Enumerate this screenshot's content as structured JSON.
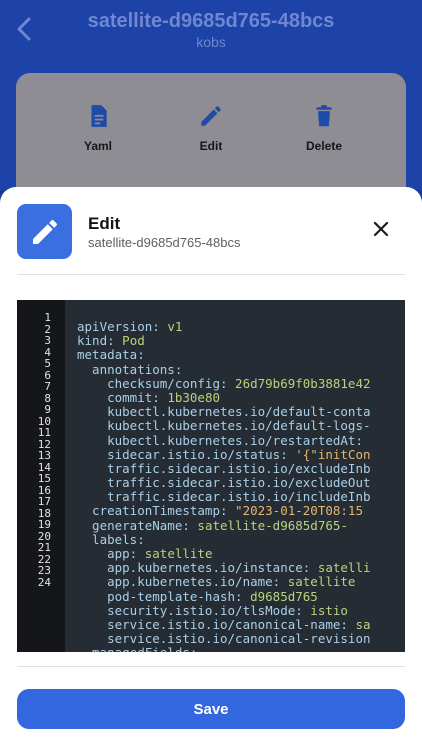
{
  "header": {
    "title": "satellite-d9685d765-48bcs",
    "subtitle": "kobs"
  },
  "actions": {
    "yaml_label": "Yaml",
    "edit_label": "Edit",
    "delete_label": "Delete"
  },
  "sheet": {
    "title": "Edit",
    "subtitle": "satellite-d9685d765-48bcs",
    "save_label": "Save"
  },
  "editor": {
    "line_numbers": [
      "1",
      "2",
      "3",
      "4",
      "5",
      "6",
      "7",
      "8",
      "9",
      "10",
      "11",
      "12",
      "13",
      "14",
      "15",
      "16",
      "17",
      "18",
      "19",
      "20",
      "21",
      "22",
      "23",
      "24"
    ],
    "lines": [
      "apiVersion: v1",
      "kind: Pod",
      "metadata:",
      "  annotations:",
      "    checksum/config: 26d79b69f0b3881e42",
      "    commit: 1b30e80",
      "    kubectl.kubernetes.io/default-conta",
      "    kubectl.kubernetes.io/default-logs-",
      "    kubectl.kubernetes.io/restartedAt:",
      "    sidecar.istio.io/status: '{\"initCon",
      "    traffic.sidecar.istio.io/excludeInb",
      "    traffic.sidecar.istio.io/excludeOut",
      "    traffic.sidecar.istio.io/includeInb",
      "  creationTimestamp: \"2023-01-20T08:15",
      "  generateName: satellite-d9685d765-",
      "  labels:",
      "    app: satellite",
      "    app.kubernetes.io/instance: satelli",
      "    app.kubernetes.io/name: satellite",
      "    pod-template-hash: d9685d765",
      "    security.istio.io/tlsMode: istio",
      "    service.istio.io/canonical-name: sa",
      "    service.istio.io/canonical-revision",
      "  managedFields:"
    ]
  },
  "icons": {
    "back": "chevron-left-icon",
    "yaml": "document-icon",
    "edit": "pencil-icon",
    "delete": "trash-icon",
    "close": "close-icon"
  },
  "colors": {
    "primary": "#3367e0",
    "header_bg": "#1e43a8",
    "editor_bg": "#262c33"
  }
}
